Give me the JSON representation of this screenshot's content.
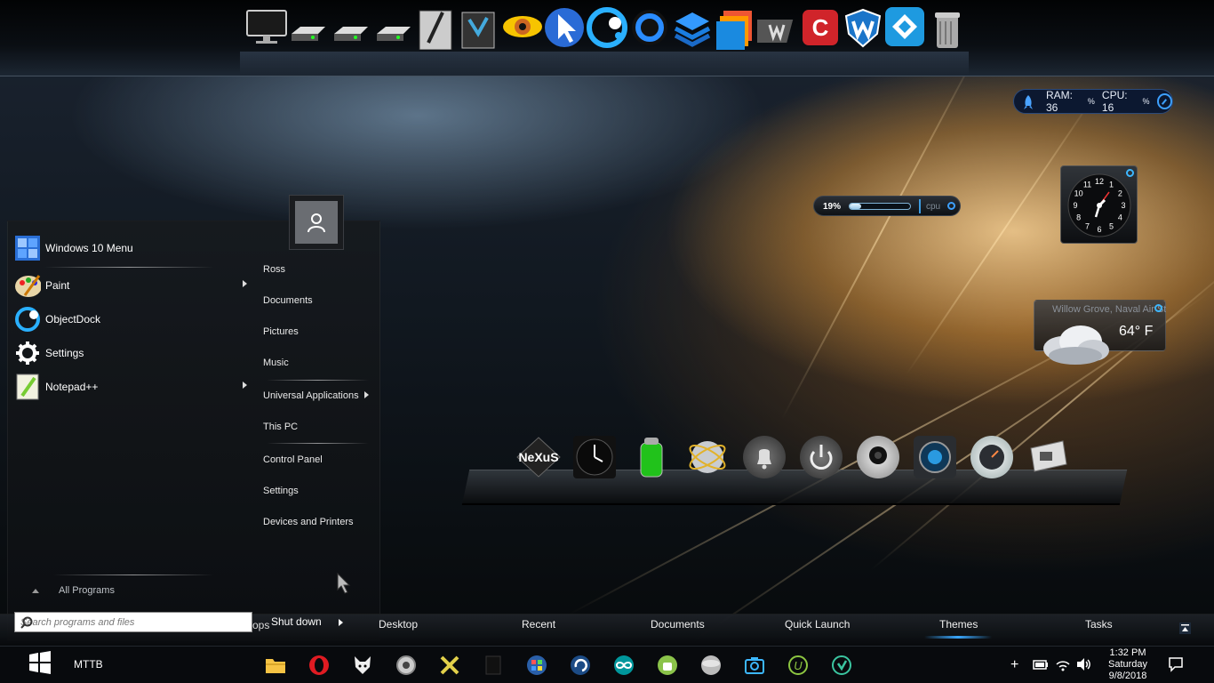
{
  "system_monitor": {
    "ram_label": "RAM: 36",
    "ram_unit": "%",
    "cpu_label": "CPU: 16",
    "cpu_unit": "%"
  },
  "cpu_meter": {
    "value_label": "19%",
    "fraction": 0.19,
    "caption": "cpu"
  },
  "clock_widget": {
    "numbers": [
      "12",
      "1",
      "2",
      "3",
      "4",
      "5",
      "6",
      "7",
      "8",
      "9",
      "10",
      "11"
    ]
  },
  "weather_widget": {
    "location": "Willow Grove, Naval Air St",
    "temperature": "64° F"
  },
  "start_menu": {
    "pinned": [
      {
        "label": "Windows 10 Menu",
        "arrow": false,
        "icon": "windows-10-menu-icon"
      },
      {
        "label": "Paint",
        "arrow": true,
        "icon": "paint-palette-icon"
      },
      {
        "label": "ObjectDock",
        "arrow": false,
        "icon": "objectdock-icon"
      },
      {
        "label": "Settings",
        "arrow": false,
        "icon": "gear-icon"
      },
      {
        "label": "Notepad++",
        "arrow": true,
        "icon": "notepadpp-icon"
      }
    ],
    "all_programs": "All Programs",
    "search_placeholder": "Search programs and files",
    "user_links": [
      "Ross",
      "Documents",
      "Pictures",
      "Music",
      "Universal Applications",
      "This PC",
      "Control Panel",
      "Settings",
      "Devices and Printers"
    ],
    "shutdown": "Shut down"
  },
  "bottom_bar": {
    "tabs": [
      "Desktop",
      "Recent",
      "Documents",
      "Quick Launch",
      "Themes",
      "Tasks"
    ],
    "active_tab": "Themes",
    "partial_text": "ops"
  },
  "taskbar": {
    "label": "MTTB",
    "time": "1:32 PM",
    "day": "Saturday",
    "date": "9/8/2018",
    "apps": [
      "file-explorer-icon",
      "opera-icon",
      "fox-icon",
      "disc-icon",
      "crossed-tools-icon",
      "notepad-icon",
      "windows7-icon",
      "reload-icon",
      "arduino-icon",
      "android-icon",
      "disk-icon",
      "camera-icon",
      "uplay-icon",
      "shield-icon"
    ]
  },
  "top_dock": {
    "icons": [
      "monitor-icon",
      "drive-icon",
      "drive-icon",
      "drive-icon",
      "notebook-icon",
      "recycle-icon",
      "eye-icon",
      "cursor-icon",
      "objectdock-icon",
      "circle-icon",
      "layers-icon",
      "windows-icon",
      "wp-icon",
      "ccleaner-icon",
      "shield-w-icon",
      "kodi-icon",
      "trash-icon"
    ]
  },
  "lower_dock": {
    "label": "NeXuS",
    "icons": [
      "nexus-logo-icon",
      "clock-icon",
      "battery-icon",
      "globe-icon",
      "bell-icon",
      "power-icon",
      "webcam-icon",
      "camera-lens-icon",
      "speedometer-icon",
      "drive-icon"
    ]
  }
}
